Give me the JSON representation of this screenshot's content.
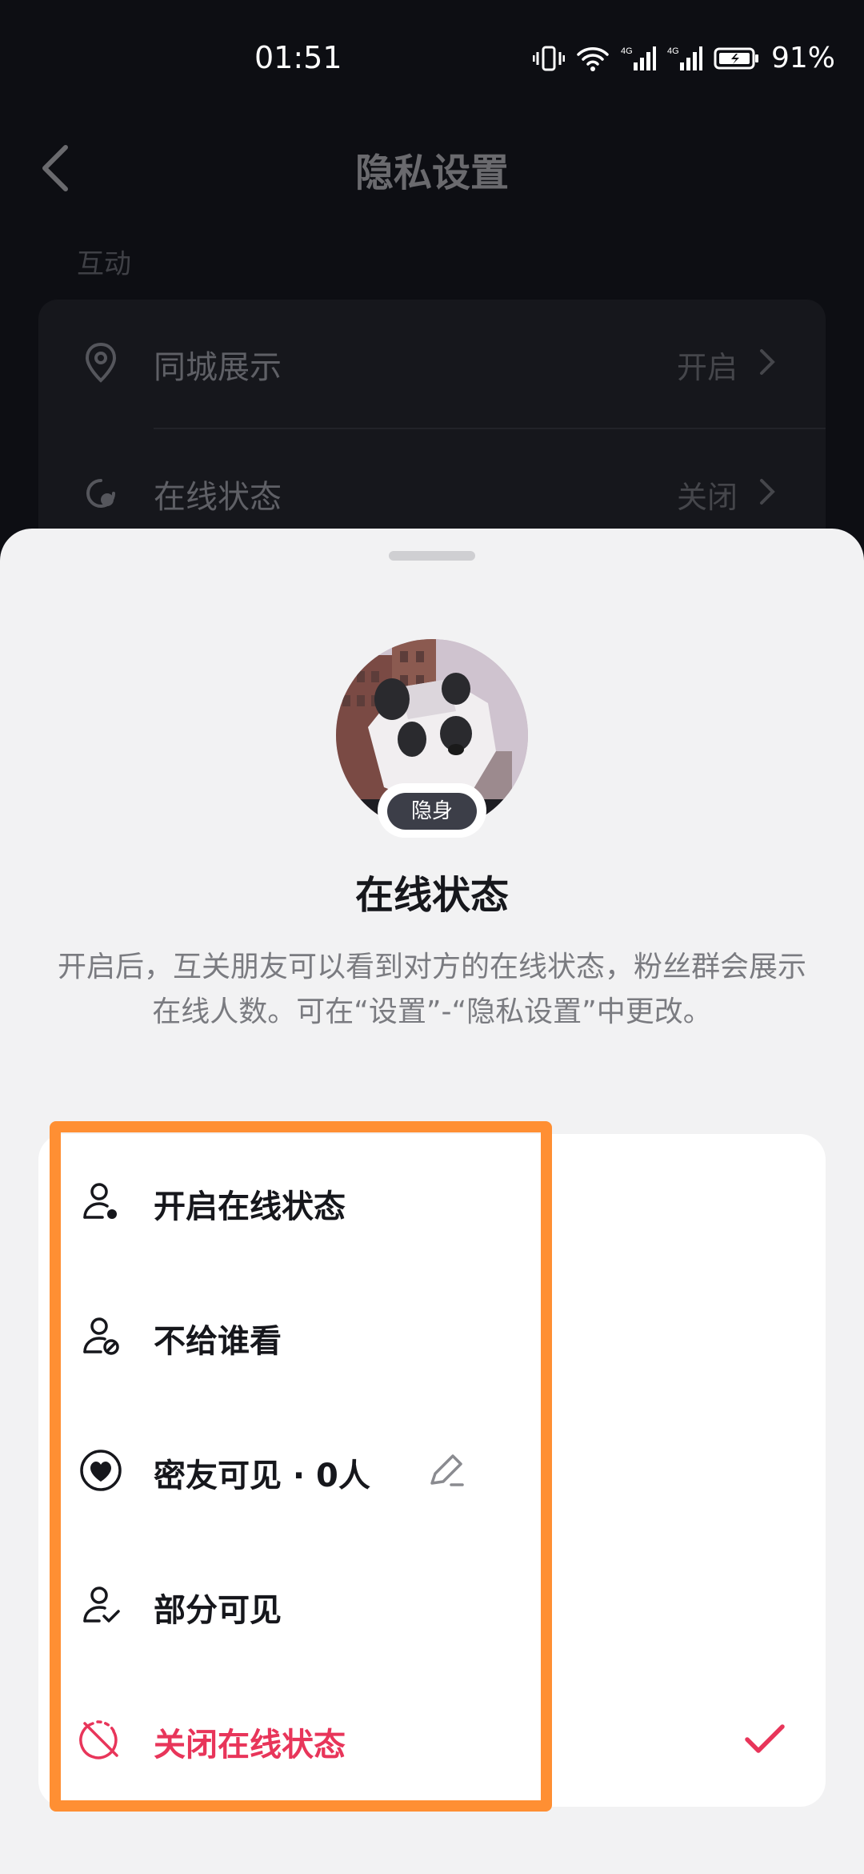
{
  "status_bar": {
    "time": "01:51",
    "network_label": "4G",
    "battery_percent": "91%"
  },
  "header": {
    "title": "隐私设置"
  },
  "section": {
    "label": "互动"
  },
  "settings": [
    {
      "label": "同城展示",
      "value": "开启"
    },
    {
      "label": "在线状态",
      "value": "关闭"
    }
  ],
  "sheet": {
    "badge": "隐身",
    "title": "在线状态",
    "description": "开启后，互关朋友可以看到对方的在线状态，粉丝群会展示在线人数。可在“设置”-“隐私设置”中更改。",
    "options": [
      {
        "label": "开启在线状态",
        "icon": "person-online-icon"
      },
      {
        "label": "不给谁看",
        "icon": "person-blocked-icon"
      },
      {
        "label": "密友可见 · 0人",
        "icon": "heart-circle-icon"
      },
      {
        "label": "部分可见",
        "icon": "person-check-icon"
      },
      {
        "label": "关闭在线状态",
        "icon": "offline-icon",
        "selected": true
      }
    ]
  },
  "colors": {
    "accent": "#e8355a",
    "highlight": "#ff8f33"
  }
}
